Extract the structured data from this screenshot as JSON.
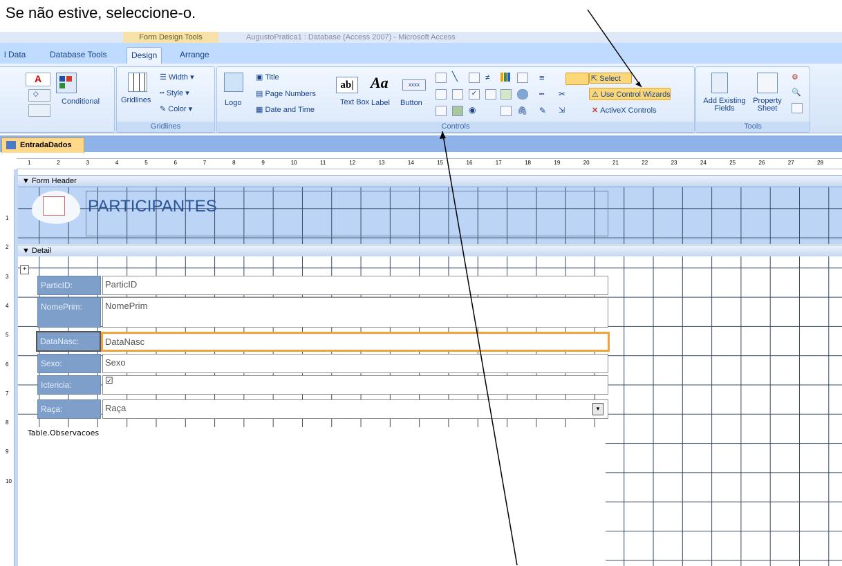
{
  "caption": "Se não estive, seleccione-o.",
  "titlebar": {
    "context_tab": "Form Design Tools",
    "window_title": "AugustoPratica1 : Database (Access 2007) - Microsoft Access"
  },
  "tabs": [
    "l Data",
    "Database Tools",
    "Design",
    "Arrange"
  ],
  "ribbon": {
    "font_group": {
      "conditional": "Conditional"
    },
    "gridlines_group": {
      "label": "Gridlines",
      "gridlines": "Gridlines",
      "width": "Width ▾",
      "style": "Style ▾",
      "color": "Color ▾"
    },
    "controls_group": {
      "label": "Controls",
      "logo": "Logo",
      "title": "Title",
      "page_numbers": "Page Numbers",
      "date_time": "Date and Time",
      "text_box": "Text Box",
      "label_btn": "Label",
      "button": "Button",
      "select": "Select",
      "use_control_wizards": "Use Control Wizards",
      "activex": "ActiveX Controls"
    },
    "tools_group": {
      "label": "Tools",
      "add_existing": "Add Existing Fields",
      "property_sheet": "Property Sheet"
    }
  },
  "document_tab": "EntradaDados",
  "ruler_numbers": [
    "1",
    "2",
    "3",
    "4",
    "5",
    "6",
    "7",
    "8",
    "9",
    "10",
    "11",
    "12",
    "13",
    "14",
    "15",
    "16",
    "17",
    "18",
    "19",
    "20",
    "21",
    "22",
    "23",
    "24",
    "25",
    "26",
    "27",
    "28"
  ],
  "vruler_numbers": [
    "1",
    "2",
    "3",
    "4",
    "5",
    "6",
    "7",
    "8",
    "9",
    "10"
  ],
  "form": {
    "header_section": "Form Header",
    "detail_section": "Detail",
    "header_title": "PARTICIPANTES",
    "fields": [
      {
        "label": "ParticID:",
        "value": "ParticID"
      },
      {
        "label": "NomePrim:",
        "value": "NomePrim"
      },
      {
        "label": "DataNasc:",
        "value": "DataNasc"
      },
      {
        "label": "Sexo:",
        "value": "Sexo"
      },
      {
        "label": "Ictericia:",
        "value": "☑"
      },
      {
        "label": "Raça:",
        "value": "Raça"
      }
    ],
    "subform_label": "Table.Observacoes"
  }
}
